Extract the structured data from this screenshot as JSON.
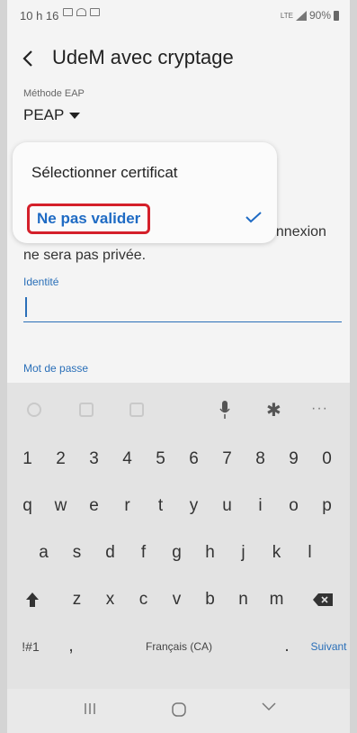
{
  "status_bar": {
    "time": "10 h 16",
    "network": "LTE",
    "battery": "90%"
  },
  "header": {
    "back_icon": "chevron-left-icon",
    "title": "UdeM avec cryptage"
  },
  "form": {
    "eap_method_label": "Méthode EAP",
    "eap_method_value": "PEAP",
    "warning_fragment": "onnexion",
    "warning_line2": "ne sera pas privée.",
    "identity_label": "Identité",
    "identity_value": "",
    "password_label": "Mot de passe"
  },
  "dropdown": {
    "options": [
      {
        "label": "Sélectionner certificat",
        "selected": false
      },
      {
        "label": "Ne pas valider",
        "selected": true
      }
    ],
    "check_icon": "checkmark-icon"
  },
  "keyboard": {
    "toolbar_icons": [
      "emoji-icon",
      "sticker-icon",
      "gif-icon",
      "microphone-icon",
      "gear-icon",
      "more-icon"
    ],
    "row_numbers": [
      "1",
      "2",
      "3",
      "4",
      "5",
      "6",
      "7",
      "8",
      "9",
      "0"
    ],
    "row_top": [
      "q",
      "w",
      "e",
      "r",
      "t",
      "y",
      "u",
      "i",
      "o",
      "p"
    ],
    "row_middle": [
      "a",
      "s",
      "d",
      "f",
      "g",
      "h",
      "j",
      "k",
      "l"
    ],
    "row_bottom": [
      "z",
      "x",
      "c",
      "v",
      "b",
      "n",
      "m"
    ],
    "symbols_key": "!#1",
    "comma_key": ",",
    "space_label": "Français (CA)",
    "period_key": ".",
    "action_key": "Suivant"
  },
  "colors": {
    "accent": "#1f6bc4",
    "highlight_border": "#d4202a"
  }
}
